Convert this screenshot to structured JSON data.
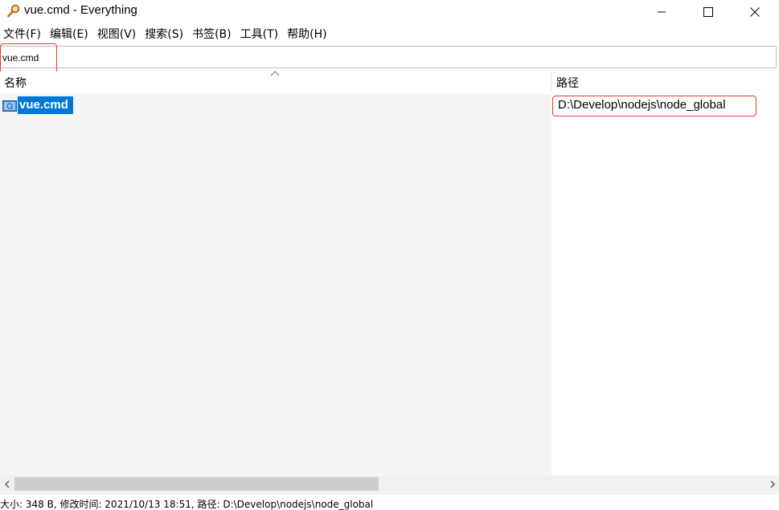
{
  "window": {
    "title": "vue.cmd - Everything",
    "icons": {
      "app": "magnifier-key-icon",
      "minimize": "minimize-icon",
      "maximize": "maximize-icon",
      "close": "close-icon"
    }
  },
  "menu": {
    "items": [
      "文件(F)",
      "编辑(E)",
      "视图(V)",
      "搜索(S)",
      "书签(B)",
      "工具(T)",
      "帮助(H)"
    ]
  },
  "search": {
    "value": "vue.cmd",
    "placeholder": ""
  },
  "columns": {
    "name": "名称",
    "path": "路径",
    "sort": "ascending"
  },
  "results": [
    {
      "name": "vue.cmd",
      "path": "D:\\Develop\\nodejs\\node_global",
      "icon": "cmd-file-icon",
      "selected": true
    }
  ],
  "status": {
    "text": "大小: 348 B, 修改时间: 2021/10/13 18:51, 路径: D:\\Develop\\nodejs\\node_global"
  },
  "colors": {
    "selection": "#0078d7",
    "highlight_box": "#e53935"
  }
}
